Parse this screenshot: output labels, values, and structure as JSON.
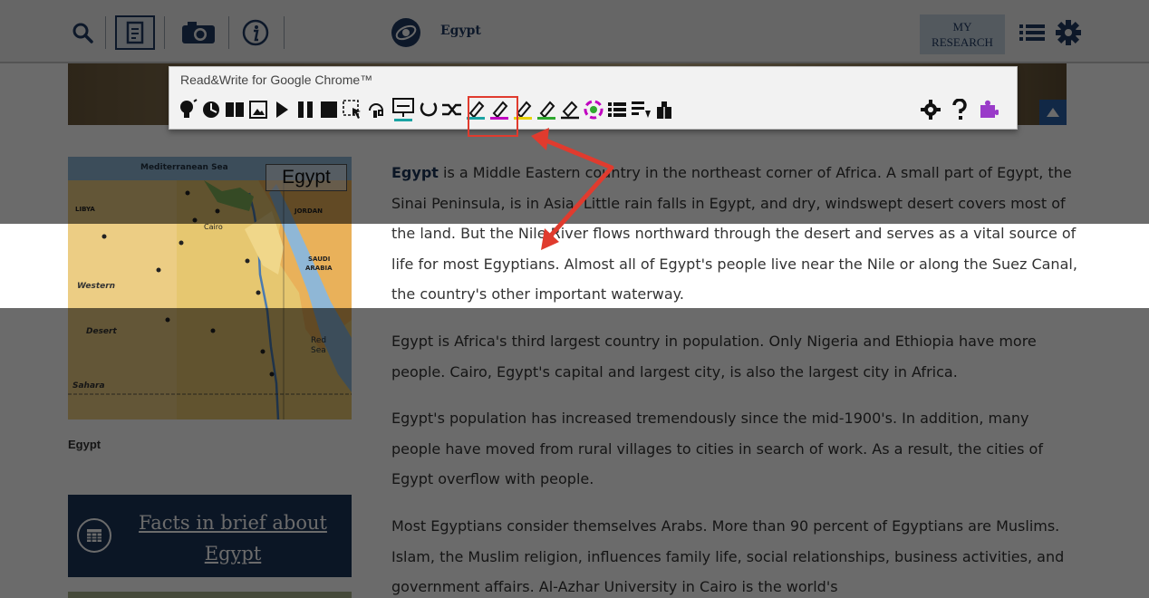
{
  "topbar": {
    "site_title": "Egypt",
    "my_research_line1": "MY",
    "my_research_line2": "RESEARCH",
    "icons": [
      "search-icon",
      "page-icon",
      "camera-icon",
      "info-icon",
      "list-icon",
      "gear-icon"
    ]
  },
  "readwrite": {
    "title": "Read&Write for Google Chrome™",
    "tool_icons": [
      "hover-speech",
      "predict",
      "dictionary",
      "picture-dictionary",
      "play",
      "pause",
      "stop",
      "screenshot-reader",
      "audio-maker",
      "screen-mask",
      "talk-type",
      "translator",
      "highlight-cyan",
      "highlight-magenta",
      "highlight-yellow",
      "highlight-green",
      "clear-highlights",
      "vocabulary",
      "collect-highlights",
      "simplify",
      "check-it",
      "settings",
      "help",
      "extension"
    ],
    "highlight_colors": [
      "#1aa3a3",
      "#c000c0",
      "#e8d300",
      "#2fa82f"
    ]
  },
  "map_caption": "Egypt",
  "map_label": "Egypt",
  "facts": {
    "title": "Facts in brief about Egypt"
  },
  "article": {
    "p1_lead": "Egypt",
    "p1_rest": " is a Middle Eastern country in the northeast corner of Africa. A small part of Egypt, the Sinai Peninsula, is in Asia. Little rain falls in Egypt, and dry, windswept desert covers most of the land. But the Nile River flows northward through the desert and serves as a vital source of life for most Egyptians. Almost all of Egypt's people live near the Nile or along the Suez Canal, the country's other important waterway.",
    "p2": "Egypt is Africa's third largest country in population. Only Nigeria and Ethiopia have more people. Cairo, Egypt's capital and largest city, is also the largest city in Africa.",
    "p3": "Egypt's population has increased tremendously since the mid-1900's. In addition, many people have moved from rural villages to cities in search of work. As a result, the cities of Egypt overflow with people.",
    "p4": "Most Egyptians consider themselves Arabs. More than 90 percent of Egyptians are Muslims. Islam, the Muslim religion, influences family life, social relationships, business activities, and government affairs. Al-Azhar University in Cairo is the world's"
  }
}
